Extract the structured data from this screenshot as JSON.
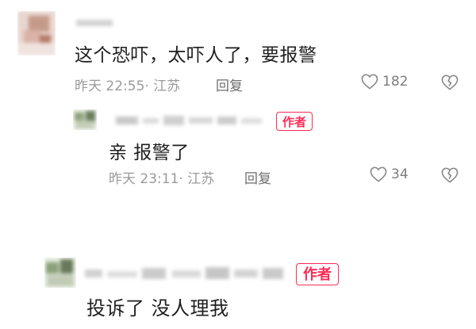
{
  "comments": [
    {
      "text": "这个恐吓，太吓人了，要报警",
      "time": "昨天 22:55",
      "location": "江苏",
      "reply_label": "回复",
      "likes": "182"
    },
    {
      "badge": "作者",
      "text": "亲 报警了",
      "time": "昨天 23:11",
      "location": "江苏",
      "reply_label": "回复",
      "likes": "34"
    },
    {
      "badge": "作者",
      "text": "投诉了 没人理我"
    }
  ],
  "colors": {
    "accent": "#ff2b55",
    "meta": "#9a9a9a"
  },
  "icons": [
    "heart-outline-icon",
    "broken-heart-icon"
  ]
}
